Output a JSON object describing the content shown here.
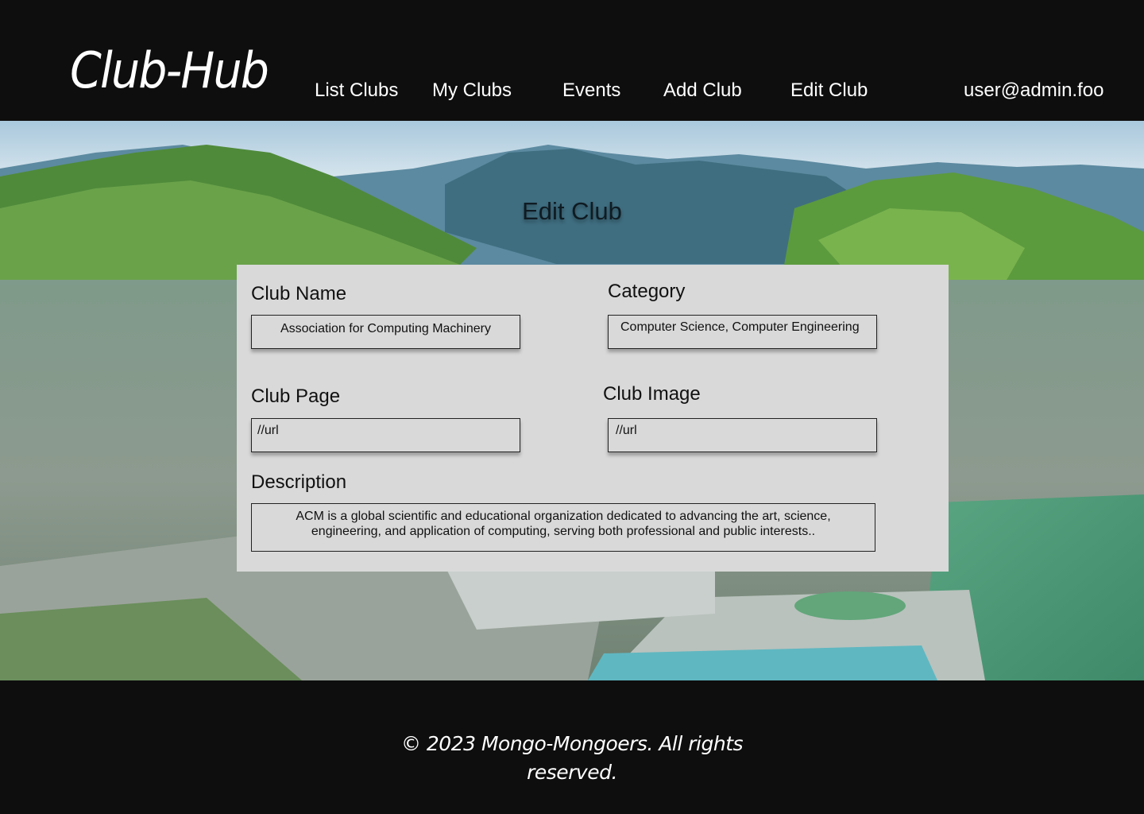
{
  "header": {
    "logo": "Club-Hub",
    "nav": [
      {
        "label": "List Clubs"
      },
      {
        "label": "My Clubs"
      },
      {
        "label": "Events"
      },
      {
        "label": "Add Club"
      },
      {
        "label": "Edit Club"
      }
    ],
    "user": "user@admin.foo"
  },
  "main": {
    "title": "Edit Club",
    "form": {
      "club_name": {
        "label": "Club Name",
        "value": "Association for Computing Machinery"
      },
      "category": {
        "label": "Category",
        "value": "Computer Science, Computer Engineering"
      },
      "club_page": {
        "label": "Club Page",
        "value": "//url"
      },
      "club_image": {
        "label": "Club Image",
        "value": "//url"
      },
      "description": {
        "label": "Description",
        "line1": "ACM is a global scientific and educational organization dedicated to advancing the art, science,",
        "line2": "engineering, and application of computing, serving both professional and public interests.."
      }
    }
  },
  "footer": {
    "line1": "© 2023 Mongo-Mongoers. All rights",
    "line2": "reserved."
  },
  "colors": {
    "header_bg": "#0e0e0e",
    "card_bg": "#d9d9d9",
    "text_light": "#ffffff"
  }
}
